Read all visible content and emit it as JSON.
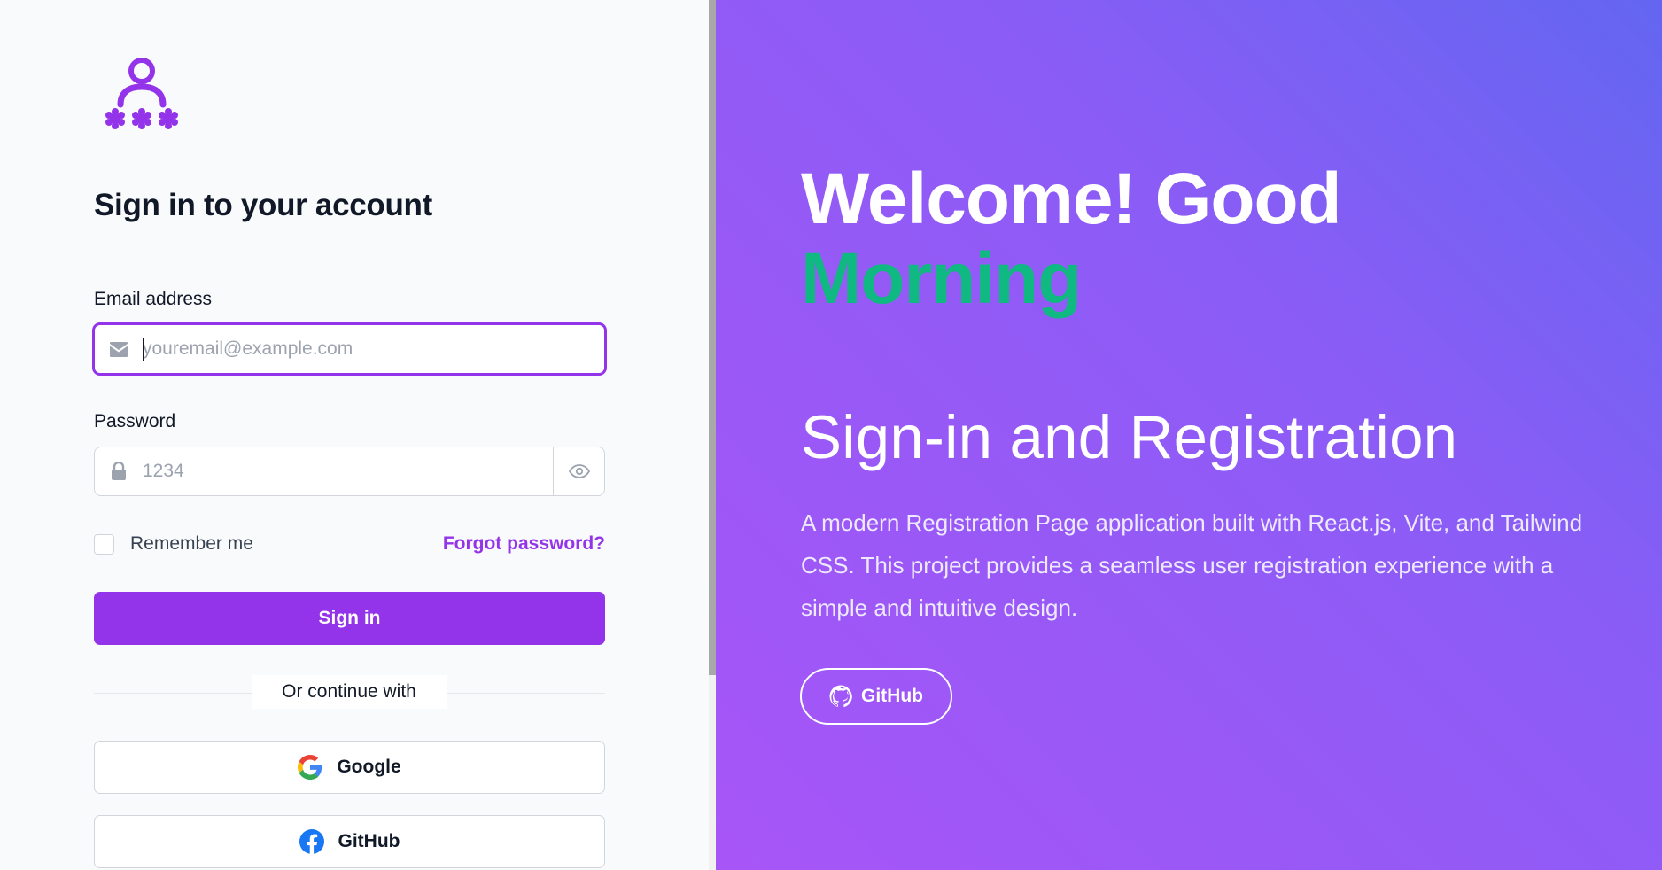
{
  "signin": {
    "title": "Sign in to your account",
    "email_label": "Email address",
    "email_placeholder": "youremail@example.com",
    "password_label": "Password",
    "password_placeholder": "1234",
    "remember_label": "Remember me",
    "forgot_label": "Forgot password?",
    "submit_label": "Sign in",
    "divider_text": "Or continue with",
    "social": [
      {
        "label": "Google",
        "icon": "google-icon"
      },
      {
        "label": "GitHub",
        "icon": "facebook-icon"
      }
    ]
  },
  "hero": {
    "welcome_text": "Welcome! Good",
    "greeting_time": "Morning",
    "subtitle": "Sign-in and Registration",
    "description": "A modern Registration Page application built with React.js, Vite, and Tailwind CSS. This project provides a seamless user registration experience with a simple and intuitive design.",
    "github_label": "GitHub"
  },
  "colors": {
    "accent": "#9333ea",
    "green": "#10b981",
    "gradient_start": "#6366f1",
    "gradient_end": "#a855f7"
  },
  "icons": {
    "logo": "user-password-icon",
    "email": "envelope-icon",
    "password": "lock-icon",
    "toggle_visibility": "eye-icon",
    "github_pill": "github-icon"
  }
}
